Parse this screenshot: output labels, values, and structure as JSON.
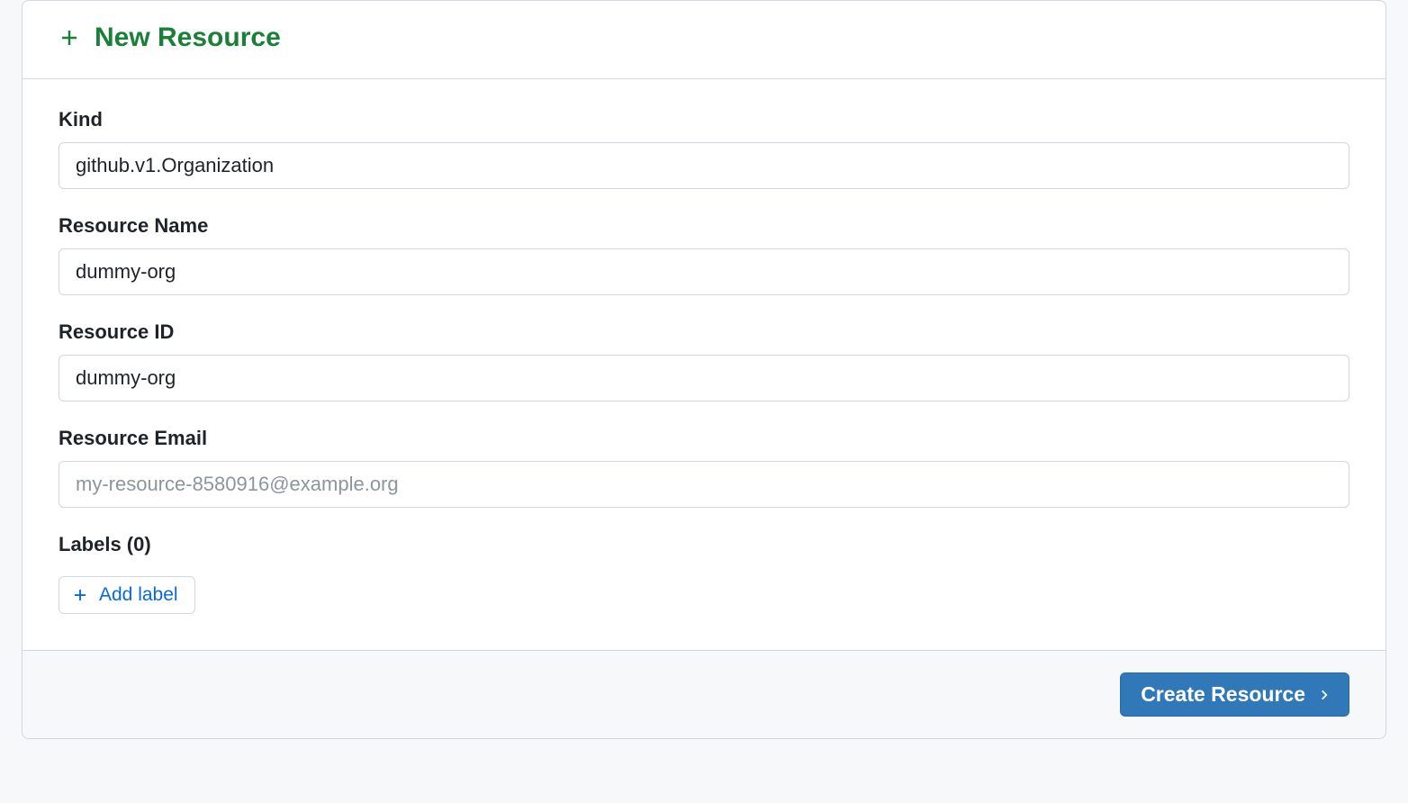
{
  "header": {
    "title": "New Resource"
  },
  "form": {
    "kind": {
      "label": "Kind",
      "value": "github.v1.Organization"
    },
    "resource_name": {
      "label": "Resource Name",
      "value": "dummy-org"
    },
    "resource_id": {
      "label": "Resource ID",
      "value": "dummy-org"
    },
    "resource_email": {
      "label": "Resource Email",
      "value": "",
      "placeholder": "my-resource-8580916@example.org"
    },
    "labels": {
      "label": "Labels (0)",
      "add_button": "Add label"
    }
  },
  "footer": {
    "create_button": "Create Resource"
  }
}
